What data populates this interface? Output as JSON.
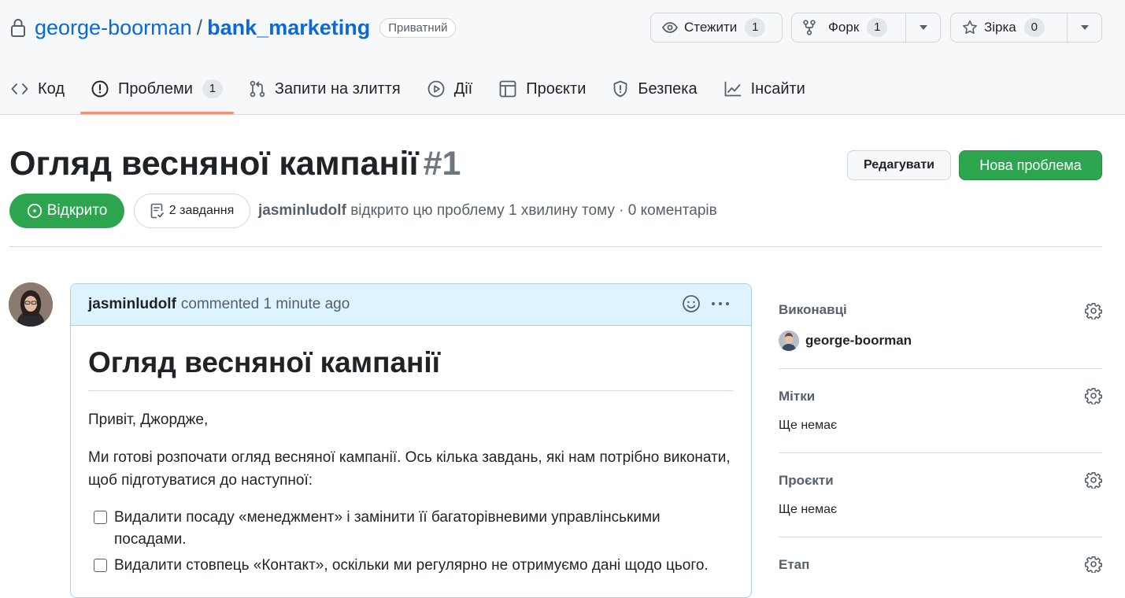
{
  "repo": {
    "owner": "george-boorman",
    "separator": "/",
    "name": "bank_marketing",
    "visibility": "Приватний"
  },
  "actions": {
    "watch": {
      "label": "Стежити",
      "count": "1"
    },
    "fork": {
      "label": "Форк",
      "count": "1"
    },
    "star": {
      "label": "Зірка",
      "count": "0"
    }
  },
  "tabs": [
    {
      "label": "Код",
      "icon": "code-icon"
    },
    {
      "label": "Проблеми",
      "icon": "issue-icon",
      "count": "1",
      "active": true
    },
    {
      "label": "Запити на злиття",
      "icon": "pull-request-icon"
    },
    {
      "label": "Дії",
      "icon": "play-icon"
    },
    {
      "label": "Проєкти",
      "icon": "table-icon"
    },
    {
      "label": "Безпека",
      "icon": "shield-icon"
    },
    {
      "label": "Інсайти",
      "icon": "graph-icon"
    }
  ],
  "issue": {
    "title": "Огляд весняної кампанії",
    "number": "#1",
    "edit_label": "Редагувати",
    "new_issue_label": "Нова проблема",
    "state": "Відкрито",
    "tasks": "2 завдання",
    "author": "jasminludolf",
    "meta": "відкрито цю проблему 1 хвилину тому · 0 коментарів"
  },
  "comment": {
    "author": "jasminludolf",
    "meta": "commented 1 minute ago",
    "heading": "Огляд весняної кампанії",
    "greeting": "Привіт, Джордже,",
    "intro": "Ми готові розпочати огляд весняної кампанії. Ось кілька завдань, які нам потрібно виконати, щоб підготуватися до наступної:",
    "tasks": [
      "Видалити посаду «менеджмент» і замінити її багаторівневими управлінськими посадами.",
      "Видалити стовпець «Контакт», оскільки ми регулярно не отримуємо дані щодо цього."
    ]
  },
  "sidebar": {
    "assignees": {
      "title": "Виконавці",
      "user": "george-boorman"
    },
    "labels": {
      "title": "Мітки",
      "value": "Ще немає"
    },
    "projects": {
      "title": "Проєкти",
      "value": "Ще немає"
    },
    "milestone": {
      "title": "Етап"
    }
  },
  "colors": {
    "accent_green": "#2da44e",
    "link_blue": "#0969da",
    "tab_underline": "#fd8c73",
    "comment_header": "#ddf4ff"
  }
}
